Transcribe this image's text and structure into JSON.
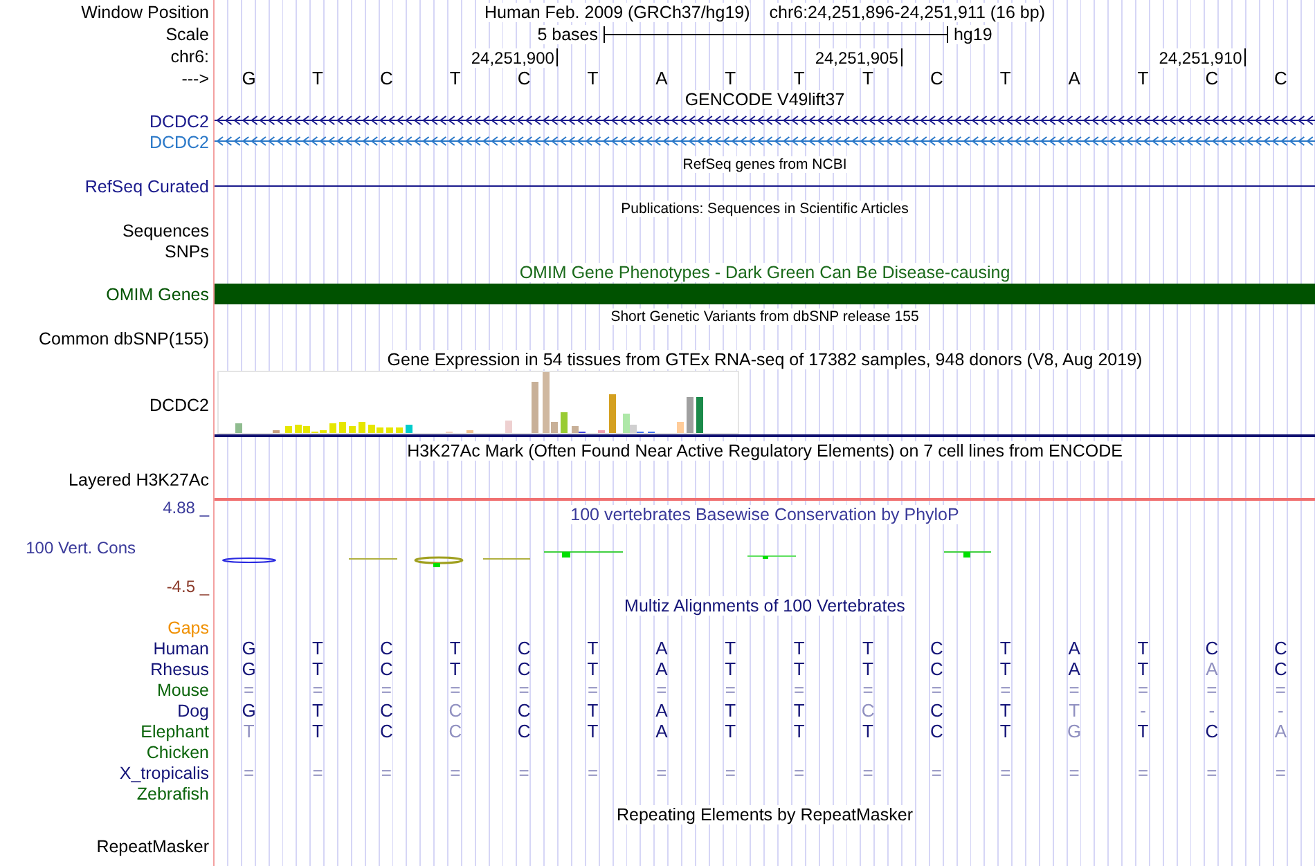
{
  "window_position": {
    "label": "Window Position",
    "assembly": "Human Feb. 2009 (GRCh37/hg19)",
    "range": "chr6:24,251,896-24,251,911 (16 bp)"
  },
  "scale": {
    "label": "Scale",
    "span": "5 bases",
    "assembly": "hg19"
  },
  "ruler": {
    "label": "chr6:",
    "ticks": [
      "24,251,900",
      "24,251,905",
      "24,251,910"
    ]
  },
  "sequence": {
    "label": "--->",
    "bases": [
      "G",
      "T",
      "C",
      "T",
      "C",
      "T",
      "A",
      "T",
      "T",
      "T",
      "C",
      "T",
      "A",
      "T",
      "C",
      "C"
    ]
  },
  "rows": [
    {
      "kind": "title",
      "text": "GENCODE V49lift37",
      "color": "#000000"
    },
    {
      "kind": "gene",
      "label": "DCDC2",
      "color": "#1a1a8c"
    },
    {
      "kind": "gene",
      "label": "DCDC2",
      "color": "#2a78c8"
    },
    {
      "kind": "note",
      "text": "RefSeq genes from NCBI"
    },
    {
      "kind": "line",
      "label": "RefSeq Curated",
      "color": "#1a1a8c"
    },
    {
      "kind": "note",
      "text": "Publications: Sequences in Scientific Articles"
    },
    {
      "kind": "empty",
      "label": "Sequences",
      "color": "#000000"
    },
    {
      "kind": "empty",
      "label": "SNPs",
      "color": "#000000"
    },
    {
      "kind": "title",
      "text": "OMIM Gene Phenotypes - Dark Green Can Be Disease-causing",
      "color": "#1a6a1a"
    },
    {
      "kind": "bar",
      "label": "OMIM Genes",
      "color": "#005200"
    },
    {
      "kind": "note",
      "text": "Short Genetic Variants from dbSNP release 155"
    },
    {
      "kind": "empty",
      "label": "Common dbSNP(155)",
      "color": "#000000"
    },
    {
      "kind": "title",
      "text": "Gene Expression in 54 tissues from GTEx RNA-seq of 17382 samples, 948 donors (V8, Aug 2019)",
      "color": "#000000"
    },
    {
      "kind": "expression",
      "label": "DCDC2",
      "color": "#000000"
    },
    {
      "kind": "title",
      "text": "H3K27Ac Mark (Often Found Near Active Regulatory Elements) on 7 cell lines from ENCODE",
      "color": "#000000"
    },
    {
      "kind": "signal",
      "label": "Layered H3K27Ac",
      "color": "#000000"
    },
    {
      "kind": "conservation",
      "label": "100 Vert. Cons",
      "color": "#3a3a9a",
      "title": "100 vertebrates Basewise Conservation by PhyloP",
      "max": "4.88 _",
      "min": "-4.5 _"
    },
    {
      "kind": "title",
      "text": "Multiz Alignments of 100 Vertebrates",
      "color": "#141478"
    },
    {
      "kind": "empty",
      "label": "Gaps",
      "color": "#f09000"
    },
    {
      "kind": "alignment",
      "label": "Human",
      "color": "#141478",
      "bases": [
        {
          "base": "G",
          "faded": false
        },
        {
          "base": "T",
          "faded": false
        },
        {
          "base": "C",
          "faded": false
        },
        {
          "base": "T",
          "faded": false
        },
        {
          "base": "C",
          "faded": false
        },
        {
          "base": "T",
          "faded": false
        },
        {
          "base": "A",
          "faded": false
        },
        {
          "base": "T",
          "faded": false
        },
        {
          "base": "T",
          "faded": false
        },
        {
          "base": "T",
          "faded": false
        },
        {
          "base": "C",
          "faded": false
        },
        {
          "base": "T",
          "faded": false
        },
        {
          "base": "A",
          "faded": false
        },
        {
          "base": "T",
          "faded": false
        },
        {
          "base": "C",
          "faded": false
        },
        {
          "base": "C",
          "faded": false
        }
      ]
    },
    {
      "kind": "alignment",
      "label": "Rhesus",
      "color": "#141478",
      "bases": [
        {
          "base": "G",
          "faded": false
        },
        {
          "base": "T",
          "faded": false
        },
        {
          "base": "C",
          "faded": false
        },
        {
          "base": "T",
          "faded": false
        },
        {
          "base": "C",
          "faded": false
        },
        {
          "base": "T",
          "faded": false
        },
        {
          "base": "A",
          "faded": false
        },
        {
          "base": "T",
          "faded": false
        },
        {
          "base": "T",
          "faded": false
        },
        {
          "base": "T",
          "faded": false
        },
        {
          "base": "C",
          "faded": false
        },
        {
          "base": "T",
          "faded": false
        },
        {
          "base": "A",
          "faded": false
        },
        {
          "base": "T",
          "faded": false
        },
        {
          "base": "A",
          "faded": true
        },
        {
          "base": "C",
          "faded": false
        }
      ]
    },
    {
      "kind": "alignment",
      "label": "Mouse",
      "color": "#0a640a",
      "bases": [
        {
          "base": "=",
          "faded": true
        },
        {
          "base": "=",
          "faded": true
        },
        {
          "base": "=",
          "faded": true
        },
        {
          "base": "=",
          "faded": true
        },
        {
          "base": "=",
          "faded": true
        },
        {
          "base": "=",
          "faded": true
        },
        {
          "base": "=",
          "faded": true
        },
        {
          "base": "=",
          "faded": true
        },
        {
          "base": "=",
          "faded": true
        },
        {
          "base": "=",
          "faded": true
        },
        {
          "base": "=",
          "faded": true
        },
        {
          "base": "=",
          "faded": true
        },
        {
          "base": "=",
          "faded": true
        },
        {
          "base": "=",
          "faded": true
        },
        {
          "base": "=",
          "faded": true
        },
        {
          "base": "=",
          "faded": true
        }
      ]
    },
    {
      "kind": "alignment",
      "label": "Dog",
      "color": "#141478",
      "bases": [
        {
          "base": "G",
          "faded": false
        },
        {
          "base": "T",
          "faded": false
        },
        {
          "base": "C",
          "faded": false
        },
        {
          "base": "C",
          "faded": true
        },
        {
          "base": "C",
          "faded": false
        },
        {
          "base": "T",
          "faded": false
        },
        {
          "base": "A",
          "faded": false
        },
        {
          "base": "T",
          "faded": false
        },
        {
          "base": "T",
          "faded": false
        },
        {
          "base": "C",
          "faded": true
        },
        {
          "base": "C",
          "faded": false
        },
        {
          "base": "T",
          "faded": false
        },
        {
          "base": "T",
          "faded": true
        },
        {
          "base": "-",
          "faded": true
        },
        {
          "base": "-",
          "faded": true
        },
        {
          "base": "-",
          "faded": true
        }
      ]
    },
    {
      "kind": "alignment",
      "label": "Elephant",
      "color": "#0a640a",
      "bases": [
        {
          "base": "T",
          "faded": true
        },
        {
          "base": "T",
          "faded": false
        },
        {
          "base": "C",
          "faded": false
        },
        {
          "base": "C",
          "faded": true
        },
        {
          "base": "C",
          "faded": false
        },
        {
          "base": "T",
          "faded": false
        },
        {
          "base": "A",
          "faded": false
        },
        {
          "base": "T",
          "faded": false
        },
        {
          "base": "T",
          "faded": false
        },
        {
          "base": "T",
          "faded": false
        },
        {
          "base": "C",
          "faded": false
        },
        {
          "base": "T",
          "faded": false
        },
        {
          "base": "G",
          "faded": true
        },
        {
          "base": "T",
          "faded": false
        },
        {
          "base": "C",
          "faded": false
        },
        {
          "base": "A",
          "faded": true
        }
      ]
    },
    {
      "kind": "empty",
      "label": "Chicken",
      "color": "#0a640a"
    },
    {
      "kind": "alignment",
      "label": "X_tropicalis",
      "color": "#141478",
      "bases": [
        {
          "base": "=",
          "faded": true
        },
        {
          "base": "=",
          "faded": true
        },
        {
          "base": "=",
          "faded": true
        },
        {
          "base": "=",
          "faded": true
        },
        {
          "base": "=",
          "faded": true
        },
        {
          "base": "=",
          "faded": true
        },
        {
          "base": "=",
          "faded": true
        },
        {
          "base": "=",
          "faded": true
        },
        {
          "base": "=",
          "faded": true
        },
        {
          "base": "=",
          "faded": true
        },
        {
          "base": "=",
          "faded": true
        },
        {
          "base": "=",
          "faded": true
        },
        {
          "base": "=",
          "faded": true
        },
        {
          "base": "=",
          "faded": true
        },
        {
          "base": "=",
          "faded": true
        },
        {
          "base": "=",
          "faded": true
        }
      ]
    },
    {
      "kind": "empty",
      "label": "Zebrafish",
      "color": "#0a640a"
    },
    {
      "kind": "title",
      "text": "Repeating Elements by RepeatMasker",
      "color": "#000000"
    },
    {
      "kind": "tall",
      "label": "RepeatMasker",
      "color": "#000000"
    }
  ]
}
